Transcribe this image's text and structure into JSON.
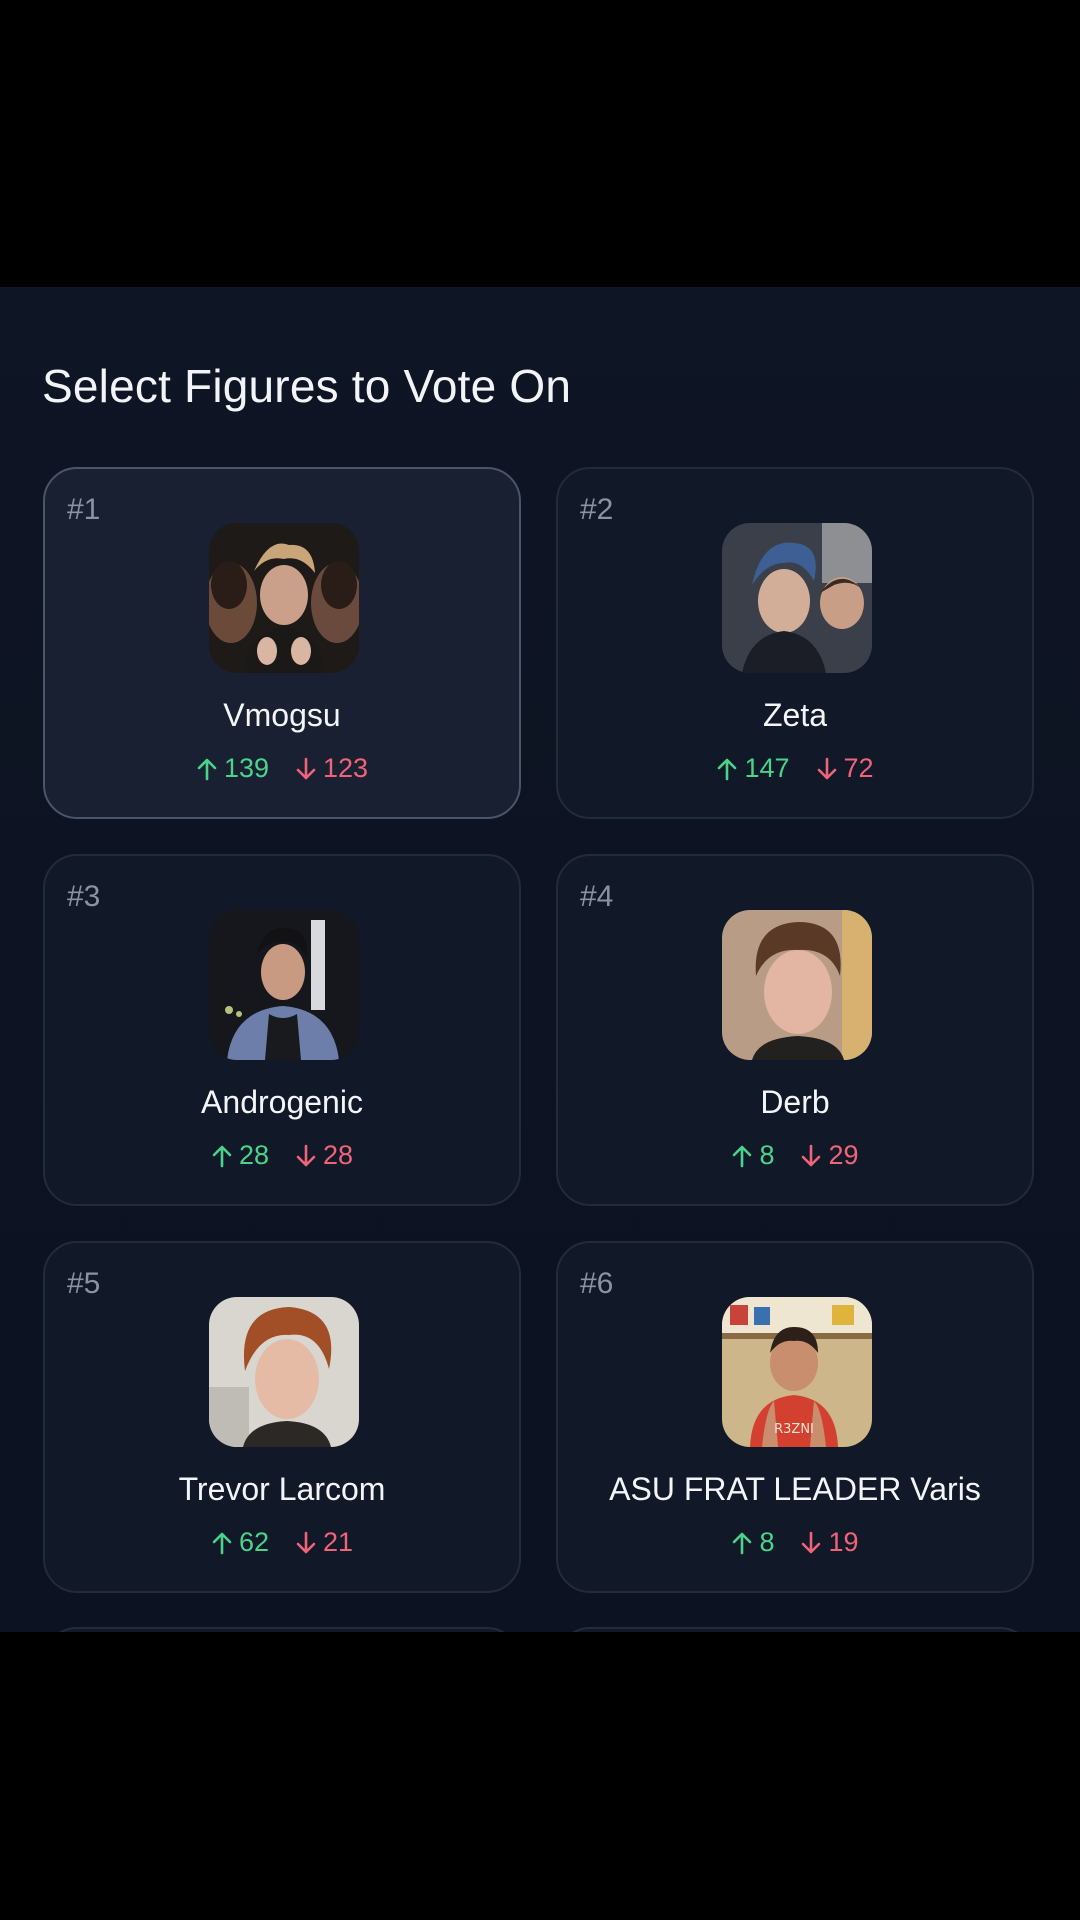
{
  "page": {
    "title": "Select Figures to Vote On"
  },
  "figures": [
    {
      "rank": "#1",
      "name": "Vmogsu",
      "up": "139",
      "down": "123",
      "selected": true
    },
    {
      "rank": "#2",
      "name": "Zeta",
      "up": "147",
      "down": "72",
      "selected": false
    },
    {
      "rank": "#3",
      "name": "Androgenic",
      "up": "28",
      "down": "28",
      "selected": false
    },
    {
      "rank": "#4",
      "name": "Derb",
      "up": "8",
      "down": "29",
      "selected": false
    },
    {
      "rank": "#5",
      "name": "Trevor Larcom",
      "up": "62",
      "down": "21",
      "selected": false
    },
    {
      "rank": "#6",
      "name": "ASU FRAT LEADER Varis",
      "up": "8",
      "down": "19",
      "selected": false
    }
  ],
  "icons": {
    "upvote": "arrow-up-icon",
    "downvote": "arrow-down-icon"
  },
  "colors": {
    "up": "#4ad48a",
    "down": "#f06478",
    "background": "#0d1322",
    "card": "#111827"
  }
}
